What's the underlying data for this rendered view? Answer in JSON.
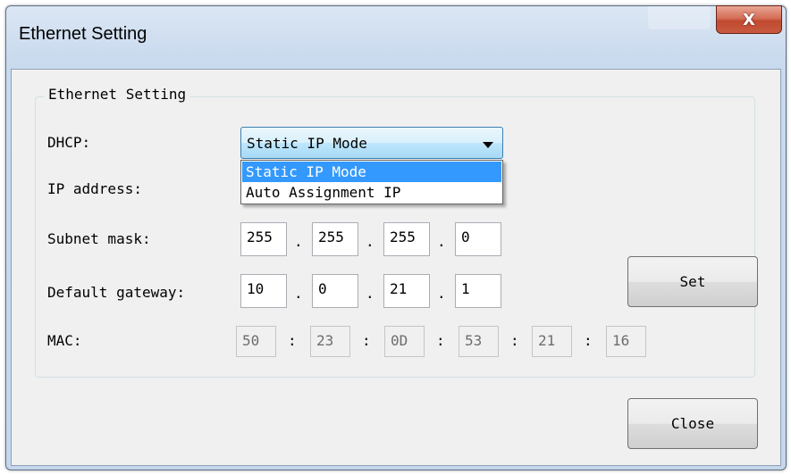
{
  "window": {
    "title": "Ethernet Setting",
    "close_glyph": "X"
  },
  "group": {
    "title": "Ethernet Setting"
  },
  "dhcp": {
    "label": "DHCP:",
    "selected": "Static IP Mode",
    "options": [
      "Static IP Mode",
      "Auto Assignment IP"
    ]
  },
  "ip_address": {
    "label": "IP address:"
  },
  "subnet_mask": {
    "label": "Subnet mask:",
    "octets": [
      "255",
      "255",
      "255",
      "0"
    ]
  },
  "default_gateway": {
    "label": "Default gateway:",
    "octets": [
      "10",
      "0",
      "21",
      "1"
    ]
  },
  "mac": {
    "label": "MAC:",
    "bytes": [
      "50",
      "23",
      "0D",
      "53",
      "21",
      "16"
    ]
  },
  "separators": {
    "dot": ".",
    "colon": ":"
  },
  "buttons": {
    "set": "Set",
    "close": "Close"
  },
  "colors": {
    "selection": "#3399ff",
    "close_button": "#c85a40"
  }
}
